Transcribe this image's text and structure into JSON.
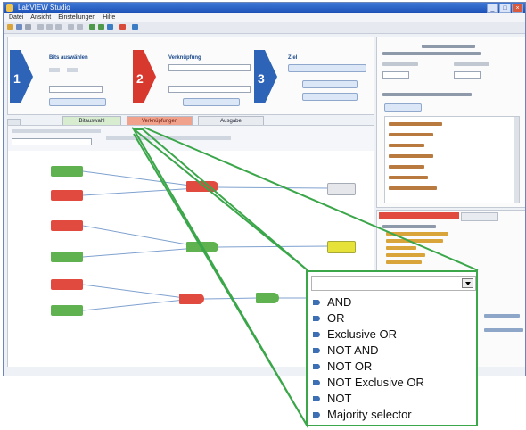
{
  "window": {
    "title": "LabVIEW Studio"
  },
  "menubar": {
    "items": [
      "Datei",
      "Ansicht",
      "Einstellungen",
      "Hilfe"
    ]
  },
  "steps": [
    {
      "number": "1",
      "title": "Bits auswählen"
    },
    {
      "number": "2",
      "title": "Verknüpfung"
    },
    {
      "number": "3",
      "title": "Ziel"
    }
  ],
  "tabs": [
    {
      "label": "Bitauswahl"
    },
    {
      "label": "Verknüpfungen"
    },
    {
      "label": "Ausgabe"
    }
  ],
  "gate_dropdown": {
    "options": [
      "AND",
      "OR",
      "Exclusive OR",
      "NOT AND",
      "NOT OR",
      "NOT Exclusive OR",
      "NOT",
      "Majority selector"
    ]
  },
  "colors": {
    "callout_border": "#3ba64a",
    "step_blue": "#2d64b7",
    "step_red": "#d8392f",
    "node_green": "#5fb24f",
    "node_red": "#e04a3f",
    "node_yellow": "#e6e23a",
    "gate_icon": "#3c6fb4"
  }
}
